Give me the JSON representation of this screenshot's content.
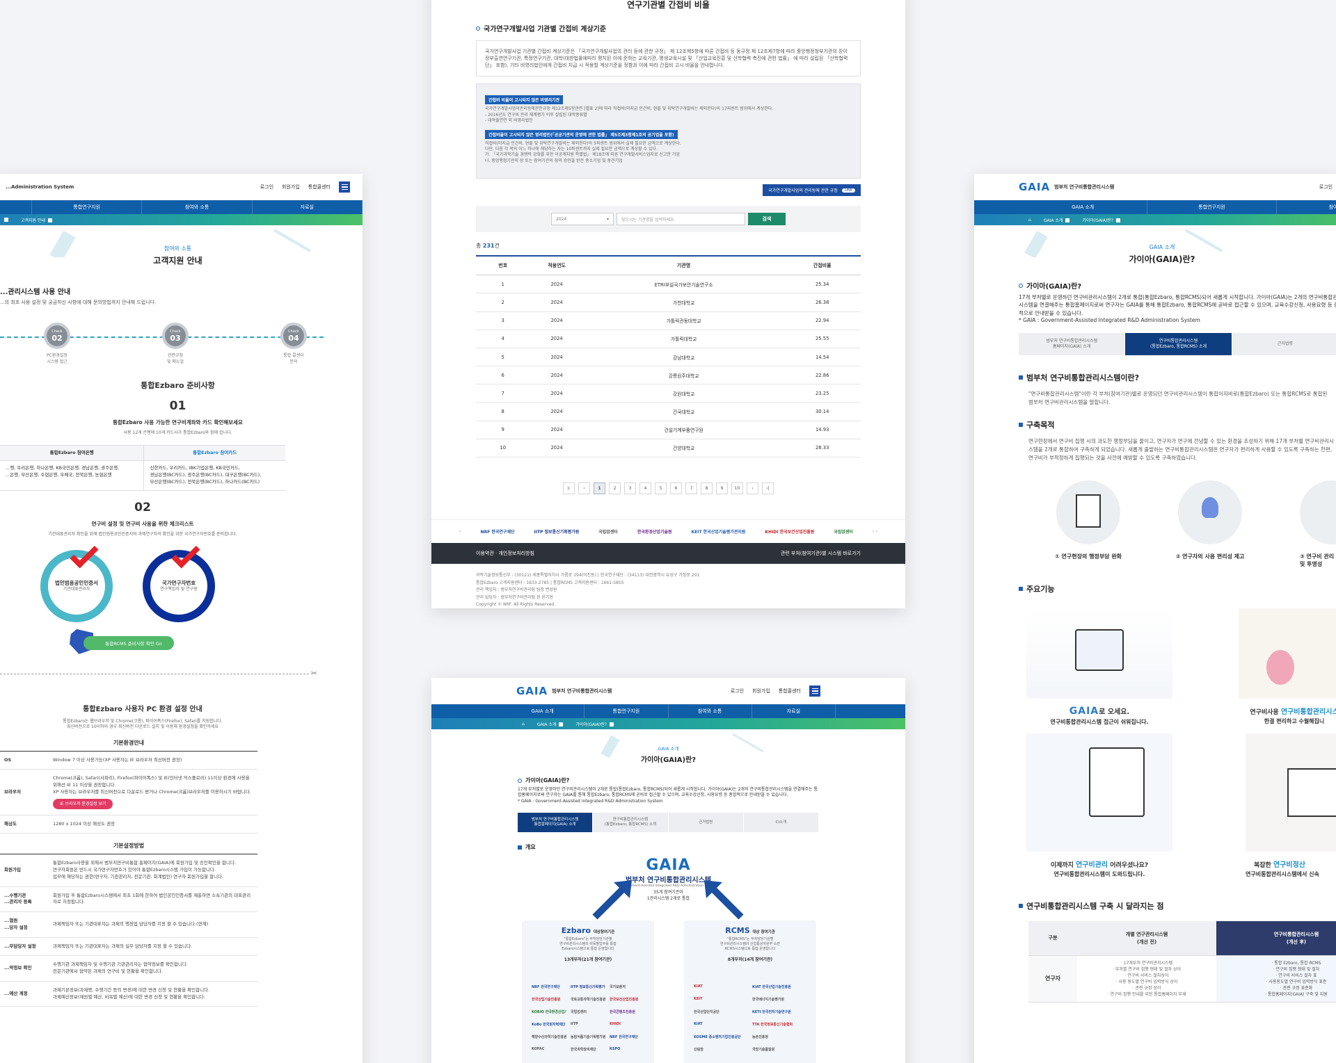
{
  "card1": {
    "logo_sub": "...Administration System",
    "utils": [
      "로그인",
      "회원가입",
      "통합콜센터"
    ],
    "gnb": [
      "통합연구지원",
      "참여와 소통",
      "자료실"
    ],
    "loc": "고객지원 안내",
    "title_sub": "참여와 소통",
    "title": "고객지원 안내",
    "section": "...관리시스템 사용 안내",
    "section_desc": "...의 최초 사용 설정 및 궁금하신 사항에 대해 문의방법까지 안내해 드립니다.",
    "checks": [
      {
        "word": "Check",
        "num": "02",
        "label": "PC환경설정\n시스템 접근"
      },
      {
        "word": "Check",
        "num": "03",
        "label": "관련규정\n및 매뉴얼"
      },
      {
        "word": "Check",
        "num": "04",
        "label": "통합 콜센터\n문의"
      }
    ],
    "prep_title": "통합Ezbaro 준비사항",
    "prep1_num": "01",
    "prep1_title": "통합Ezbaro 사용 가능한 연구비계좌와 카드 확인해보세요",
    "prep1_desc": "사용 12개 은행에 10개 카드사가 통합Ezbaro와 함께 합니다.",
    "bank_head": "통합Ezbaro 참여은행",
    "card_head": "통합Ezbaro 참여카드",
    "bank_list": "...행, 우리은행, 하나은행, KB국민은행, 경남은행, 광주은행,\n...은행, 부산은행, 수협은행, 우체국, 전북은행, 농협은행",
    "card_list": "신한카드, 우리카드, IBK기업은행, KB국민카드,\n경남은행(BC카드), 광주은행(BC카드), 대구은행(BC카드),\n부산은행(BC카드), 전북은행(BC카드), 하나카드(BC카드)",
    "prep2_num": "02",
    "prep2_title": "연구비 설정 및 연구비 사용을 위한 체크리스트",
    "prep2_desc": "기관대표관리자 확인을 위해 법인범용공인인증서와 과제연구자의 확인을 위한 국가연구자번호를 준비합니다.",
    "ring1": {
      "title": "법인범용공인인증서",
      "sub": "기관대표관리자"
    },
    "ring2": {
      "title": "국가연구자번호",
      "sub": "연구책임자 및 연구원"
    },
    "rcms_btn": "통합RCMS 준비사항 확인 Go",
    "env_title": "통합Ezbaro 사용자 PC 환경 설정 안내",
    "env_desc": "통합Ezbaro는 웹브라우저 및 Chrome(크롬), 파이어폭스(Firefox), Safari를 지원합니다.\n최신버전으로 10이하의 경우 최신버전 다운로드 설치 및 이용해 환경설정을 확인하세요",
    "env_sub1": "기본환경안내",
    "env_rows": [
      {
        "k": "OS",
        "v": "Window 7 이상 사용가능(XP 사용자는 IE 브라우저 최신버전 권장)"
      },
      {
        "k": "브라우저",
        "v": "Chrome(크롬), Safari(사파리), Firefox(파이어폭스) 및 IE(인터넷 익스플로러) 11이상 환경에 사용을 위해선 IE 11 이상을 권장합니다.\nXP 사용자는 브라우저를 최신버전으로 다운로드 받거나 Chrome(크롬)브라우저를 이용하시기 바랍니다."
      },
      {
        "k": "해상도",
        "v": "1280 x 1024 이상 해상도 권장"
      }
    ],
    "env_btn": "IE 브라우저 환경설정 보기",
    "env_sub2": "기본설정방법",
    "set_rows": [
      {
        "k": "회원가입",
        "v": "통합Ezbaro사용을 위해서 범부처연구비통합 홈페이지(GAIA)에 회원가입 및 승인확인을 합니다.\n연구자회원은 반드시 국가연구자번호가 있어야 통합Ezbaro시스템 가입이 가능합니다.\n업무에 해당하는 권한(연구자, 기관관리자, 전문기관, 회계법인) 연구자 회원가입을 합니다."
      },
      {
        "k": "...수행기관\n...관리자 등록",
        "v": "회원가입 후 통합Ezbaro시스템에서 최초 1회에 한하여 법인공인인증서를 제출하면 소속기관의 대표관리자로 지정됩니다."
      },
      {
        "k": "...협원\n...당자 설정",
        "v": "과제책임자 또는 기관대표자는 과제의 행정업 담당자를 지정 할 수 있습니다.(연계)"
      },
      {
        "k": "...무담당자 설정",
        "v": "과제책임자 또는 기관대표자는 과제의 실무 담당자를 지정 할 수 있습니다."
      },
      {
        "k": "...약정보 확인",
        "v": "수행기관 과제책임자 및 수행기관 기관관리자는 협약정보를 확인합니다.\n전문기관에서 협약된 과제의 연구비 및 현황을 확인합니다."
      },
      {
        "k": "...예산 계정",
        "v": "과제기본정보(과제명, 수행기간 등의 변경)에 대한 변경 신청 및 현황을 확인합니다.\n과제예산정보(재원별 예산, 비목별 예산)에 대한 변경 신청 및 현황을 확인합니다."
      }
    ]
  },
  "card2": {
    "page_title": "연구기관별 간접비 비율",
    "section": "국가연구개발사업 기관별 간접비 계상기준",
    "intro": "국가연구개발사업 기관별 간접비 계상기준은 「국가연구개발사업의 관리 등에 관한 규정」 제 12조제5항에 따른 간접비 등 동규정 제 12조제7항에 따라 중앙행정청부기관의 장이 정부출연연구기관, 특정연구기관, 대학(대한법률에따라 평치된 이에 준하는 교육기관, 평생교육시설 및 「산업교육진흥 및 산학협력 촉진에 관한 법률」 에 따라 설립된 「산학협력단」 포함), 기타 비영리법인에게 간접비 지급 시 적용할 계상기준을 정함과 이에 따라 간접비 고시 비율을 안내합니다.",
    "tag1": "간접비 비율이 고시되지 않은 비영리기관",
    "tag1_lines": [
      "국가연구개발사업의관리등에관한규정 제12조제5항관련 [별표 2]에 따라 직접비(미지급 인건비, 현물 및 위탁연구개발비는 제외한다)의 17퍼센트 범위에서 계상한다.",
      "- 2016년도 연구비 관리 체계평가 이후 설립된 대학종류별",
      "- 대학출연연 외 비영리법인"
    ],
    "tag2": "간접비율이 고시되지 않은 영리법인(「공공기관의 운영에 관한 법률」 제5조제3항제1호의 공기업을 포함)",
    "tag2_lines": [
      "직접비(미지급 인건비, 현물 및 위탁연구개발비는 제외한다)의 5퍼센트 범위에서 실제 필요한 금액으로 계상한다.",
      "다만, 다음 각 목의 어느 하나에 해당하는 자는 10퍼센트까지 실제 필요한 금액으로 계상할 수 있다.",
      "가. 「국가과학기술 경쟁력 강화를 위한 이공계지원 특별법」 제18조에 따른 연구개발서비스업자로 신고한 기업",
      "나. 중앙행정기관의 장 또는 참여기관의 장의 승인을 받은 중소기업 및 중견기업"
    ],
    "law_btn": "국가연구개발사업의 관리등에 관한 규정",
    "law_btn_tag": "LINK",
    "year": "2024",
    "search_placeholder": "찾으시는 기관명을 입력하세요.",
    "search_btn": "검색",
    "total_prefix": "총 ",
    "total": "231",
    "total_suffix": "건",
    "headers": [
      "번호",
      "적용연도",
      "기관명",
      "간접비율"
    ],
    "rows": [
      [
        "1",
        "2024",
        "ETRI부설국가보안기술연구소",
        "25.34"
      ],
      [
        "2",
        "2024",
        "가천대학교",
        "26.38"
      ],
      [
        "3",
        "2024",
        "가톨릭관동대학교",
        "22.94"
      ],
      [
        "4",
        "2024",
        "가톨릭대학교",
        "25.55"
      ],
      [
        "5",
        "2024",
        "강남대학교",
        "14.54"
      ],
      [
        "6",
        "2024",
        "강릉원주대학교",
        "22.86"
      ],
      [
        "7",
        "2024",
        "강원대학교",
        "23.25"
      ],
      [
        "8",
        "2024",
        "건국대학교",
        "30.14"
      ],
      [
        "9",
        "2024",
        "건설기계부품연구원",
        "14.93"
      ],
      [
        "10",
        "2024",
        "건양대학교",
        "28.33"
      ]
    ],
    "pages": [
      "|‹",
      "‹",
      "1",
      "2",
      "3",
      "4",
      "5",
      "6",
      "7",
      "8",
      "9",
      "10",
      "›",
      "›|"
    ],
    "partners": [
      "NRF 한국연구재단",
      "IITP 정보통신기획평가원",
      "국립암센터",
      "한국환경산업기술원",
      "KEIT 한국산업기술평가관리원",
      "KHIDI 한국보건산업진흥원",
      "국립암센터"
    ],
    "footer_left": "이용약관 · 개인정보처리방침",
    "footer_right": "관련 부처(참여기관)별 시스템 바로가기",
    "finfo": [
      "과학기술정보통신부 : (30121) 세종특별자치시 가름로 194(어진동)  |  한국연구재단 : (34113) 대전광역시 유성구 가정로 201",
      "통합Ezbaro 고객지원센터 : 1833-2785  |  통합RCMS 고객지원센터 : 1661-5855",
      "관리 책임자 : 범부처연구비관리팀 팀장 변성원",
      "관리 담당자 : 범부처연구비관리팀 정 윤기현",
      "Copyright © NRF. All Rights Reserved."
    ]
  },
  "card3": {
    "logo": "GAIA",
    "logo_text": "범부처 연구비통합관리시스템",
    "utils": [
      "로그인",
      "회원가입",
      "통합콜센터"
    ],
    "gnb": [
      "GAIA 소개",
      "통합연구지원",
      "참여와 소통",
      "자료실"
    ],
    "loc": [
      "GAIA 소개",
      "가이아(GAIA)란?"
    ],
    "title_sub": "GAIA 소개",
    "title": "가이아(GAIA)란?",
    "q": "가이아(GAIA)란?",
    "desc": "17개 부처별로 운영하던 연구비관리시스템이 2개로 통합(통합Ezbaro, 통합RCMS)되어 새롭게 시작합니다. 가이아(GAIA)는 2개의 연구비통합관리시스템을 연결해주는 통합홈페이지로써 연구자는 GAIA를 통해 통합Ezbaro, 통합RCMS에 곧바로 접근할 수 있으며, 교육수강신청, 사용요령 등 종합적으로 안내받을 수 있습니다.",
    "acr": "* GAIA : Government-Assisted Integrated R&D Administration System",
    "tabs": [
      "범부처 연구비통합관리시스템\n통합홈페이지(GAIA) 소개",
      "연구비통합관리시스템\n(통합Ezbaro, 통합RCMS) 소개",
      "근거법령",
      "CI소개"
    ],
    "overview": "개요",
    "big_logo": "GAIA",
    "big_title": "범부처 연구비통합관리시스템",
    "big_en": "Government-Assisted Integrated R&D Administration System",
    "big_desc": "35개 참여기관이\n1관리시스템 2개로 통합",
    "ez_name": "Ezbaro",
    "ez_tag": "대상참여기관",
    "ez_desc": "\"통합Ezbaro\"는 부처담당기관별\n연구비관리시스템의 비목별업무를 통합\nEzbaro시스템으로 통합 운영합니다",
    "ez_count": "13개부처(21개 참여기관)",
    "rc_name": "RCMS",
    "rc_tag": "대상 참여기관",
    "rc_desc": "\"통합RCMS\"는 부처담당기관별\n연구비관리시스템의 산업통상자원부 소관\nRCMS시스템으로 통합 운영합니다",
    "rc_count": "8개부처(14개 참여기관)",
    "ez_orgs": [
      "NRF 한국연구재단",
      "IITP 정보통신기획평가원",
      "국가보훈처",
      "한국산업기술진흥원",
      "국토교통과학기술진흥원",
      "한국보건산업진흥원",
      "KOBIO 한국환경산업기술원",
      "국립암센터",
      "한국콘텐츠진흥원",
      "KoBo 한국원자력재단",
      "IITP",
      "KHIDI",
      "해양수산과학기술진흥원",
      "농림식품기술기획평가원",
      "NRF 한국연구재단",
      "KOFAC",
      "한국과학창의재단",
      "KSPO",
      "KIAT",
      "산업통상자원부"
    ],
    "rc_orgs": [
      "KIAT",
      "KIAT 한국산업기술진흥원",
      "KEIT",
      "한국에너지기술평가원",
      "한국산업단지공단",
      "KETI 한국전자기술연구원",
      "KIAT",
      "TTA 한국정보통신기술협회",
      "KOSME 중소벤처기업진흥공단",
      "농촌진흥청",
      "산림청",
      "국방기술품질원"
    ]
  },
  "card4": {
    "logo": "GAIA",
    "logo_text": "범부처 연구비통합관리시스템",
    "utils": [
      "로그인",
      "회원"
    ],
    "gnb": [
      "GAIA 소개",
      "통합연구지원",
      "참여와 소통"
    ],
    "loc": [
      "GAIA 소개",
      "가이아(GAIA)란?"
    ],
    "title_sub": "GAIA 소개",
    "title": "가이아(GAIA)란?",
    "q": "가이아(GAIA)란?",
    "desc": "17개 부처별로 운영하던 연구비관리시스템이 2개로 통합(통합Ezbaro, 통합RCMS)되어 새롭게 시작합니다. 가이아(GAIA)는 2개의 연구비통합관리시스템을 연결해주는 통합홈페이지로써 연구자는 GAIA를 통해 통합Ezbaro, 통합RCMS에 곧바로 접근할 수 있으며, 교육수강신청, 사용요령 등 종합적으로 안내받을 수 있습니다.",
    "acr": "* GAIA : Government-Assisted Integrated R&D Administration System",
    "tabs": [
      "범부처 연구비통합관리시스템\n홈페이지(GAIA) 소개",
      "연구비통합관리시스템\n(통합Ezbaro, 통합RCMS) 소개",
      "근거법령"
    ],
    "s1": "범부처 연구비통합관리시스템이란?",
    "s1_desc": "\"연구비통합관리시스템\"이란 각 부처(참여기관)별로 운영되던 연구비관리시스템이 통합이지바로(통합Ezbaro) 또는 통합RCMS로 통합된 범부처 연구비관리시스템을 말합니다.",
    "s2": "구축목적",
    "s2_desc": "연구현장에서 연구비 집행 시의 과도한 행정부담을 줄이고, 연구자가 연구에 전념할 수 있는 환경을 조성하기 위해 17개 부처별 연구비관리시스템을 2개로 통합하여 구축하게 되었습니다. 새롭게 출발하는 연구비통합관리시스템은 연구자가 편리하게 사용할 수 있도록 구축하는 한편, 연구비가 부적정하게 집행되는 것을 사전에 예방할 수 있도록 구축하였습니다.",
    "goals": [
      "① 연구현장의 행정부담 완화",
      "② 연구자의 사용 편리성 제고",
      "③ 연구비 관리\n및 투명성"
    ],
    "s3": "주요기능",
    "f1_logo": "GAIA",
    "f1_a": "로 오세요.",
    "f1_b": "연구비통합관리시스템 접근이 쉬워집니다.",
    "f2_a": "연구비사용 ",
    "f2_hl": "연구비통합관리시스",
    "f2_b": "한결 편리하고 수월해집니",
    "f3_a": "이제까지 ",
    "f3_hl": "연구비관리",
    "f3_c": " 어려우셨나요?",
    "f3_b": "연구비통합관리시스템이 도와드립니다.",
    "f4_a": "복잡한 ",
    "f4_hl": "연구비정산",
    "f4_b": "연구비통합관리시스템에서 신속",
    "s4": "연구비통합관리시스템 구축 시 달라지는 점",
    "cmp_head": [
      "구분",
      "개별 연구관리시스템\n(개선 전)",
      "연구비통합관리시스템\n(개선 후)"
    ],
    "cmp_row_k": "연구자",
    "cmp_before": "· 17개부처 연구비관리시스템\n· 부처별 연구비 집행 형태 및 절차 상이\n· 연구비 서비스 절차상이\n· 사용 용도별 연구비 입력방식 상이\n· 관련 규정 상이\n· 연구비 집행 안내를 위한 통합홈페이지 부재",
    "cmp_after": "· 통합 Ezbaro, 통합 RCMS\n· 연구비 집행 형태 및 절차\n· 연구비 서비스 절차 표\n· 사용용도별 연구비 입력방식 표준\n· 관련 규정 표준화\n· 통합홈페이지(GAIA) 구축 및 지원"
  }
}
